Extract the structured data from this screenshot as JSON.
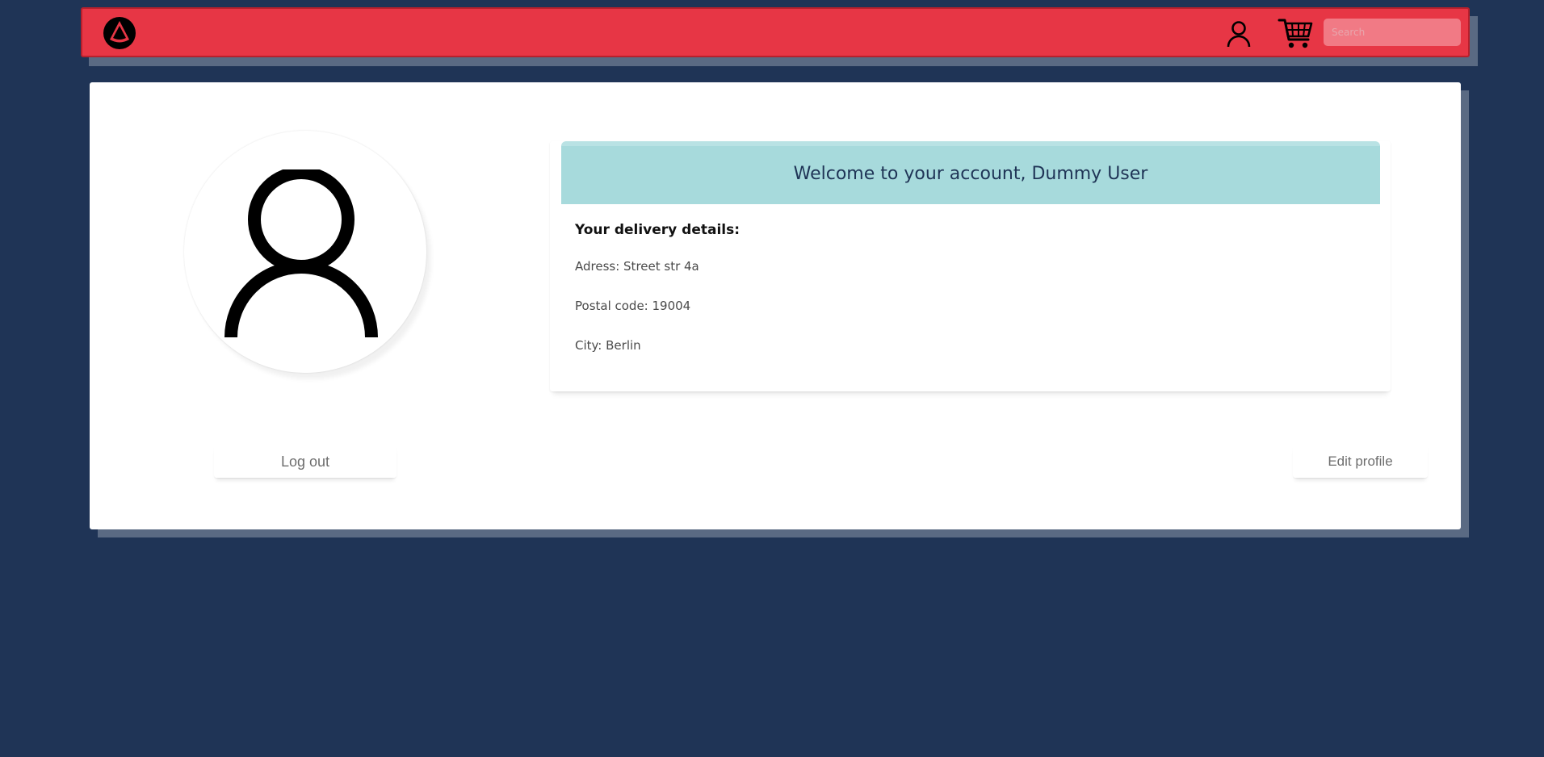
{
  "navbar": {
    "logo_icon": "brand-logo-icon",
    "user_icon": "user-icon",
    "cart_icon": "cart-icon",
    "search_placeholder": "Search",
    "background_color": "#e73645"
  },
  "profile": {
    "avatar_icon": "user-avatar-icon",
    "welcome_title": "Welcome to your account, Dummy User",
    "delivery_heading": "Your delivery details:",
    "address": "Adress: Street str 4a",
    "postal_code": "Postal code: 19004",
    "city": "City: Berlin",
    "header_color": "#a7dadc"
  },
  "actions": {
    "logout_label": "Log out",
    "edit_profile_label": "Edit profile"
  },
  "page": {
    "background_color": "#1f3456"
  }
}
